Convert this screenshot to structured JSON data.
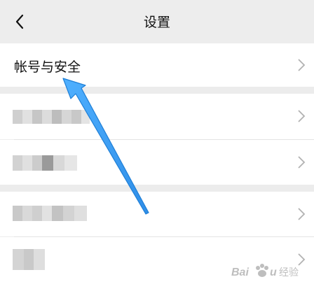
{
  "header": {
    "back_icon": "chevron-left-icon",
    "title": "设置"
  },
  "settings": {
    "account_security_label": "帐号与安全",
    "chevron_icon": "chevron-right-icon",
    "blurred_items_count_note": ""
  },
  "colors": {
    "background": "#ededed",
    "row": "#ffffff",
    "text": "#111111",
    "chevron": "#b2b2b2",
    "arrow": "#3aa0f5"
  },
  "overlay": {
    "arrow_icon": "annotation-arrow-icon",
    "watermark": "Baidu 经验"
  }
}
